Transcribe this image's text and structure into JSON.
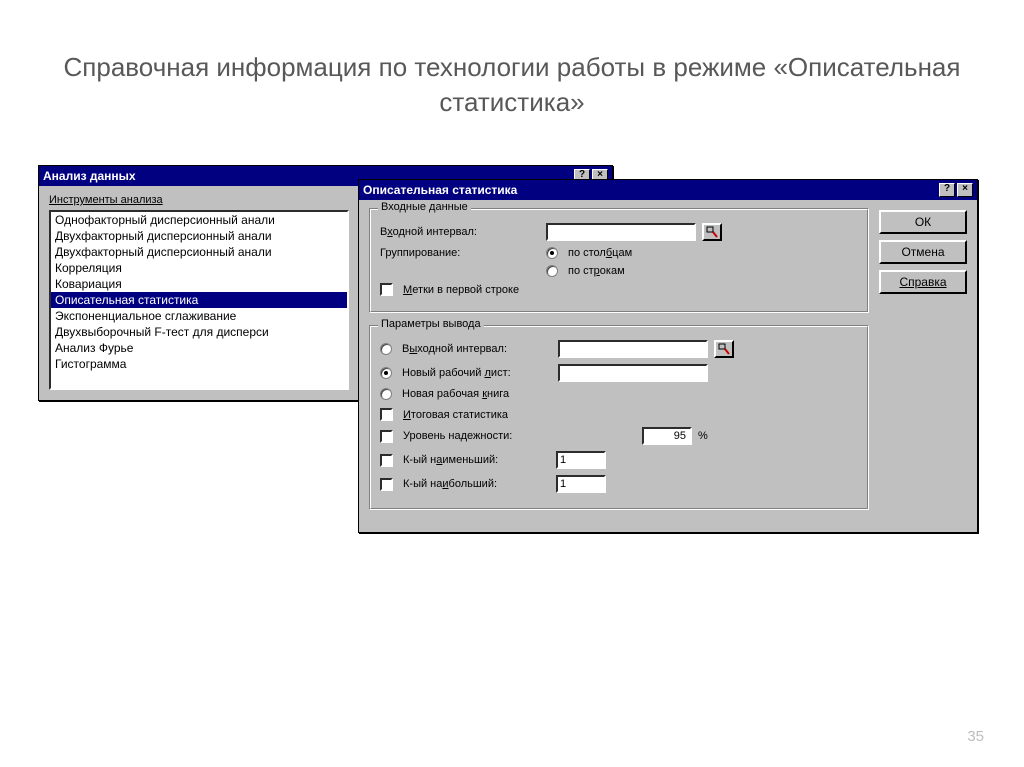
{
  "page": {
    "title": "Справочная информация по технологии работы в режиме «Описательная статистика»",
    "number": "35"
  },
  "dialog1": {
    "title": "Анализ данных",
    "tools_label": "Инструменты анализа",
    "items": [
      "Однофакторный дисперсионный анали",
      "Двухфакторный дисперсионный анали",
      "Двухфакторный дисперсионный анали",
      "Корреляция",
      "Ковариация",
      "Описательная статистика",
      "Экспоненциальное сглаживание",
      "Двухвыборочный F-тест для дисперси",
      "Анализ Фурье",
      "Гистограмма"
    ],
    "selected_index": 5
  },
  "dialog2": {
    "title": "Описательная статистика",
    "buttons": {
      "ok": "ОК",
      "cancel": "Отмена",
      "help": "Справка"
    },
    "input_group": {
      "legend": "Входные данные",
      "range_label_pre": "В",
      "range_label_u": "х",
      "range_label_post": "одной интервал:",
      "range_value": "",
      "group_label": "Группирование:",
      "by_cols_pre": "по стол",
      "by_cols_u": "б",
      "by_cols_post": "цам",
      "by_rows_pre": "по ст",
      "by_rows_u": "р",
      "by_rows_post": "окам",
      "labels_first_row_u": "М",
      "labels_first_row_post": "етки в первой строке"
    },
    "output_group": {
      "legend": "Параметры вывода",
      "out_range_pre": "В",
      "out_range_u": "ы",
      "out_range_post": "ходной интервал:",
      "out_range_value": "",
      "new_sheet_pre": "Новый рабочий ",
      "new_sheet_u": "л",
      "new_sheet_post": "ист:",
      "new_sheet_value": "",
      "new_book_pre": "Новая рабочая ",
      "new_book_u": "к",
      "new_book_post": "нига",
      "summary_u": "И",
      "summary_post": "тоговая статистика",
      "confidence_label": "Уровень надежности:",
      "confidence_value": "95",
      "percent": "%",
      "k_smallest_pre": "К-ый н",
      "k_smallest_u": "а",
      "k_smallest_post": "именьший:",
      "k_smallest_value": "1",
      "k_largest_pre": "К-ый на",
      "k_largest_u": "и",
      "k_largest_post": "больший:",
      "k_largest_value": "1"
    }
  }
}
